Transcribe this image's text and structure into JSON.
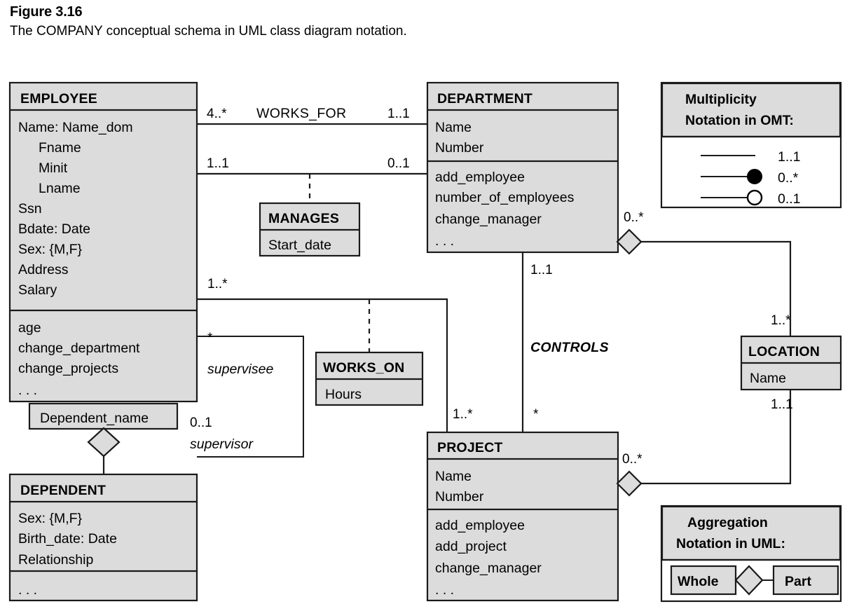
{
  "figure": {
    "number": "Figure 3.16",
    "caption": "The COMPANY conceptual schema in UML class diagram notation."
  },
  "colors": {
    "box_fill": "#dcdcdc",
    "box_stroke": "#1a1a1a",
    "page_background": "#ffffff",
    "white_fill": "#ffffff"
  },
  "classes": {
    "employee": {
      "title": "EMPLOYEE",
      "attributes": [
        "Name: Name_dom",
        "Fname",
        "Minit",
        "Lname",
        "Ssn",
        "Bdate: Date",
        "Sex: {M,F}",
        "Address",
        "Salary"
      ],
      "operations": [
        "age",
        "change_department",
        "change_projects",
        ". . ."
      ]
    },
    "department": {
      "title": "DEPARTMENT",
      "attributes": [
        "Name",
        "Number"
      ],
      "operations": [
        "add_employee",
        "number_of_employees",
        "change_manager",
        ". . ."
      ]
    },
    "project": {
      "title": "PROJECT",
      "attributes": [
        "Name",
        "Number"
      ],
      "operations": [
        "add_employee",
        "add_project",
        "change_manager",
        ". . ."
      ]
    },
    "location": {
      "title": "LOCATION",
      "attributes": [
        "Name"
      ]
    },
    "dependent": {
      "title": "DEPENDENT",
      "attributes": [
        "Sex: {M,F}",
        "Birth_date: Date",
        "Relationship"
      ],
      "operations": [
        ". . ."
      ]
    },
    "dependent_name": {
      "title": "Dependent_name"
    }
  },
  "association_classes": {
    "manages": {
      "title": "MANAGES",
      "attributes": [
        "Start_date"
      ]
    },
    "works_on": {
      "title": "WORKS_ON",
      "attributes": [
        "Hours"
      ]
    }
  },
  "associations": {
    "works_for": {
      "name": "WORKS_FOR",
      "left_multiplicity": "4..*",
      "right_multiplicity": "1..1"
    },
    "manages_link": {
      "left_multiplicity": "1..1",
      "right_multiplicity": "0..1"
    },
    "works_on_link": {
      "employee_multiplicity": "1..*",
      "project_multiplicity": "1..*"
    },
    "controls": {
      "name": "CONTROLS",
      "department_multiplicity": "1..1",
      "project_multiplicity": "*"
    },
    "supervision": {
      "supervisee_multiplicity": "*",
      "supervisee_role": "supervisee",
      "supervisor_multiplicity": "0..1",
      "supervisor_role": "supervisor"
    },
    "department_locations": {
      "department_multiplicity": "0..*",
      "location_multiplicity": "1..*"
    },
    "project_location": {
      "project_multiplicity": "0..*",
      "location_multiplicity": "1..1"
    }
  },
  "legends": {
    "multiplicity": {
      "title_line1": "Multiplicity",
      "title_line2": "Notation in OMT:",
      "items": [
        {
          "symbol": "plain-line",
          "label": "1..1"
        },
        {
          "symbol": "filled-circle-line",
          "label": "0..*"
        },
        {
          "symbol": "open-circle-line",
          "label": "0..1"
        }
      ]
    },
    "aggregation": {
      "title_line1": "Aggregation",
      "title_line2": "Notation in UML:",
      "whole_label": "Whole",
      "part_label": "Part"
    }
  }
}
